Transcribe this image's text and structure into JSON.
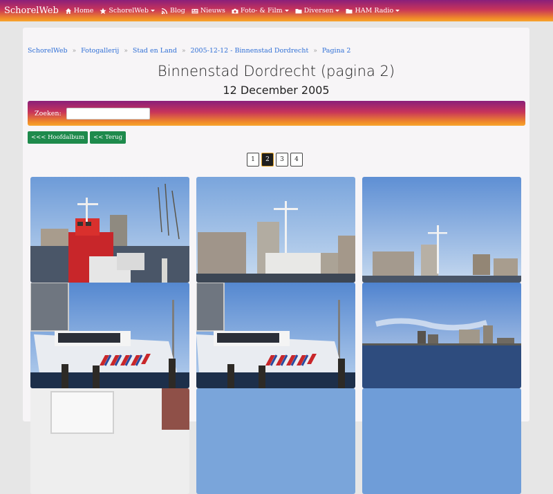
{
  "nav": {
    "brand": "SchorelWeb",
    "items": [
      {
        "label": "Home",
        "icon": "home-icon",
        "dropdown": false
      },
      {
        "label": "SchorelWeb",
        "icon": "star-icon",
        "dropdown": true
      },
      {
        "label": "Blog",
        "icon": "rss-icon",
        "dropdown": false
      },
      {
        "label": "Nieuws",
        "icon": "newspaper-icon",
        "dropdown": false
      },
      {
        "label": "Foto- & Film",
        "icon": "camera-icon",
        "dropdown": true
      },
      {
        "label": "Diversen",
        "icon": "folder-icon",
        "dropdown": true
      },
      {
        "label": "HAM Radio",
        "icon": "folder-icon",
        "dropdown": true
      }
    ]
  },
  "breadcrumb": [
    "SchorelWeb",
    "Fotogallerij",
    "Stad en Land",
    "2005-12-12 - Binnenstad Dordrecht",
    "Pagina 2"
  ],
  "breadcrumb_separator": "»",
  "page": {
    "title": "Binnenstad Dordrecht (pagina 2)",
    "subtitle": "12 December 2005"
  },
  "search": {
    "label": "Zoeken:",
    "value": ""
  },
  "buttons": {
    "main_album": "<<< Hoofdalbum",
    "back": "<< Terug"
  },
  "pagination": {
    "pages": [
      "1",
      "2",
      "3",
      "4"
    ],
    "active": "2"
  },
  "thumbnails": [
    {
      "scene": "red-pilot-boat"
    },
    {
      "scene": "ship-mast-flats"
    },
    {
      "scene": "mast-riverside"
    },
    {
      "scene": "police-boat"
    },
    {
      "scene": "police-boat"
    },
    {
      "scene": "river-skyline"
    },
    {
      "scene": "snowy-street"
    },
    {
      "scene": "sky"
    },
    {
      "scene": "sky"
    }
  ],
  "colors": {
    "accent_green": "#1e8a4c",
    "link_blue": "#2f6fd6",
    "gradient_top": "#8a1f7a",
    "gradient_bottom": "#f7a52d"
  }
}
